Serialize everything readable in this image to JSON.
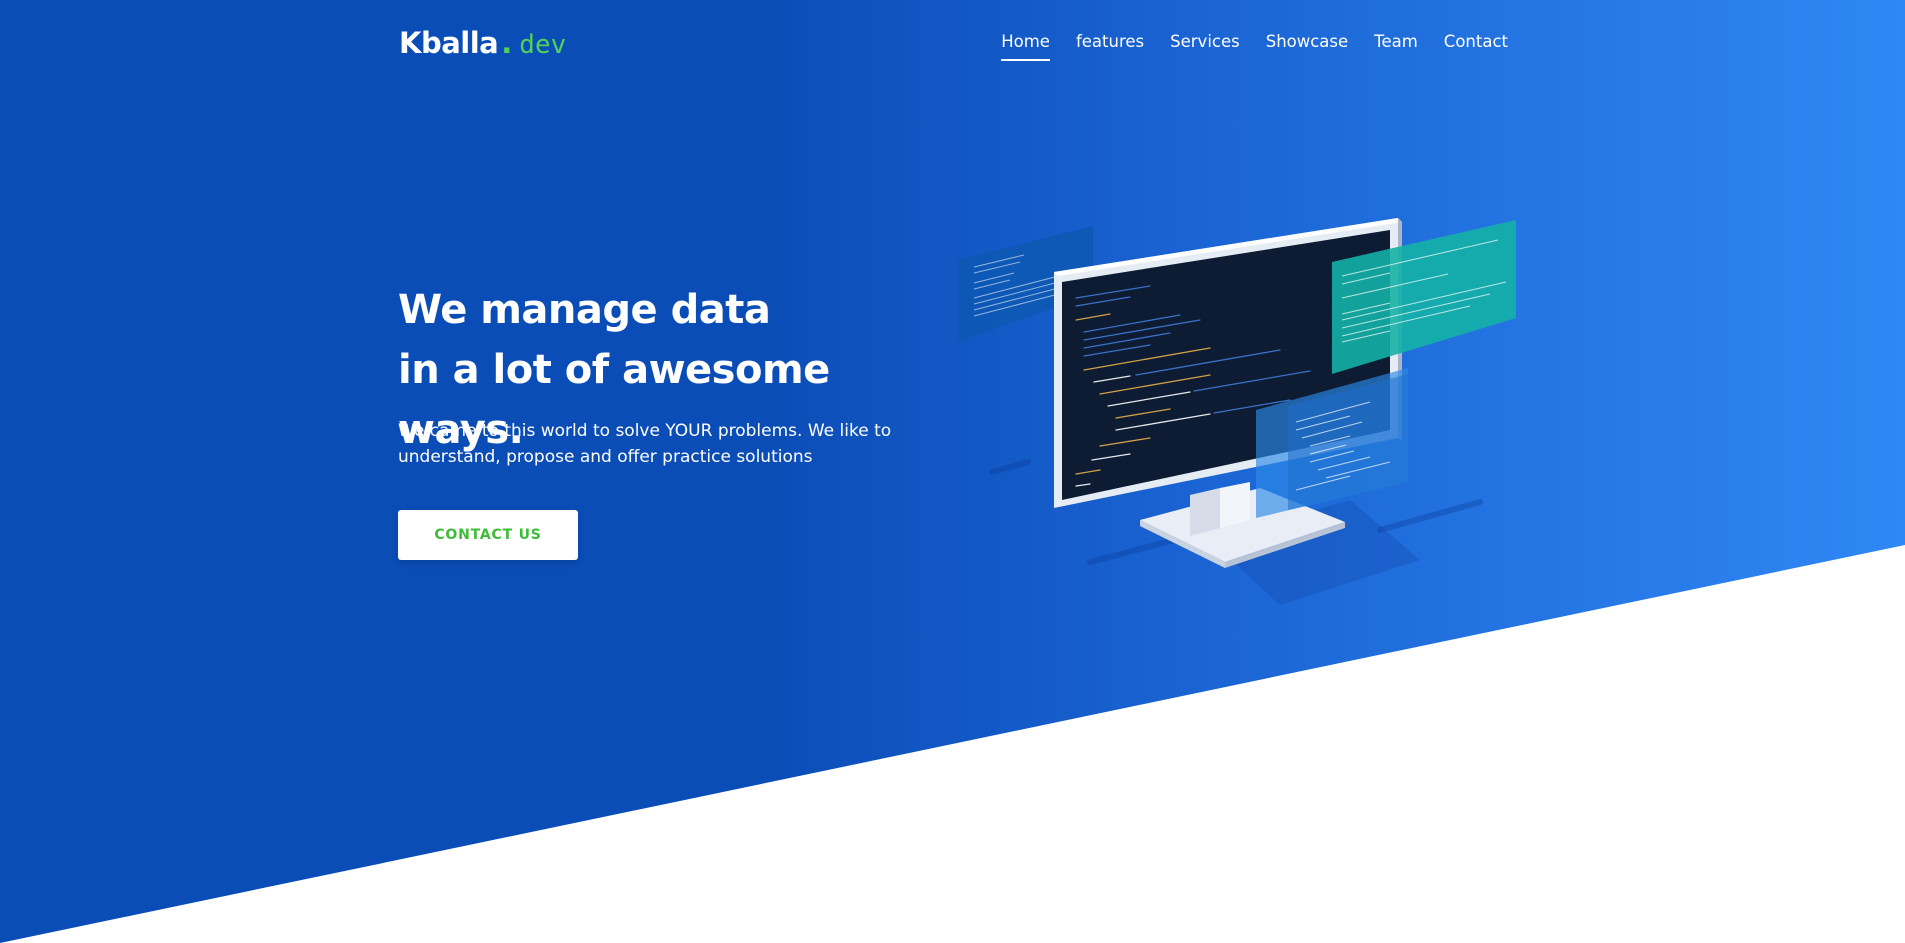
{
  "brand": {
    "name": "Kballa",
    "dot": ".",
    "suffix": "dev"
  },
  "nav": {
    "items": [
      {
        "label": "Home",
        "active": true
      },
      {
        "label": "features",
        "active": false
      },
      {
        "label": "Services",
        "active": false
      },
      {
        "label": "Showcase",
        "active": false
      },
      {
        "label": "Team",
        "active": false
      },
      {
        "label": "Contact",
        "active": false
      }
    ]
  },
  "hero": {
    "headline_line1": "We manage data",
    "headline_line2": "in a lot of awesome ways.",
    "subtext": "We came to this world to solve YOUR problems. We like to understand, propose and offer practice solutions",
    "cta_label": "CONTACT US"
  },
  "illustration": {
    "icon": "computer-monitor-code-illustration"
  },
  "colors": {
    "hero_start": "#0b4db7",
    "hero_end": "#2f88f5",
    "brand_accent": "#4fd15a",
    "cta_text": "#3dbd35",
    "background": "#ffffff"
  }
}
